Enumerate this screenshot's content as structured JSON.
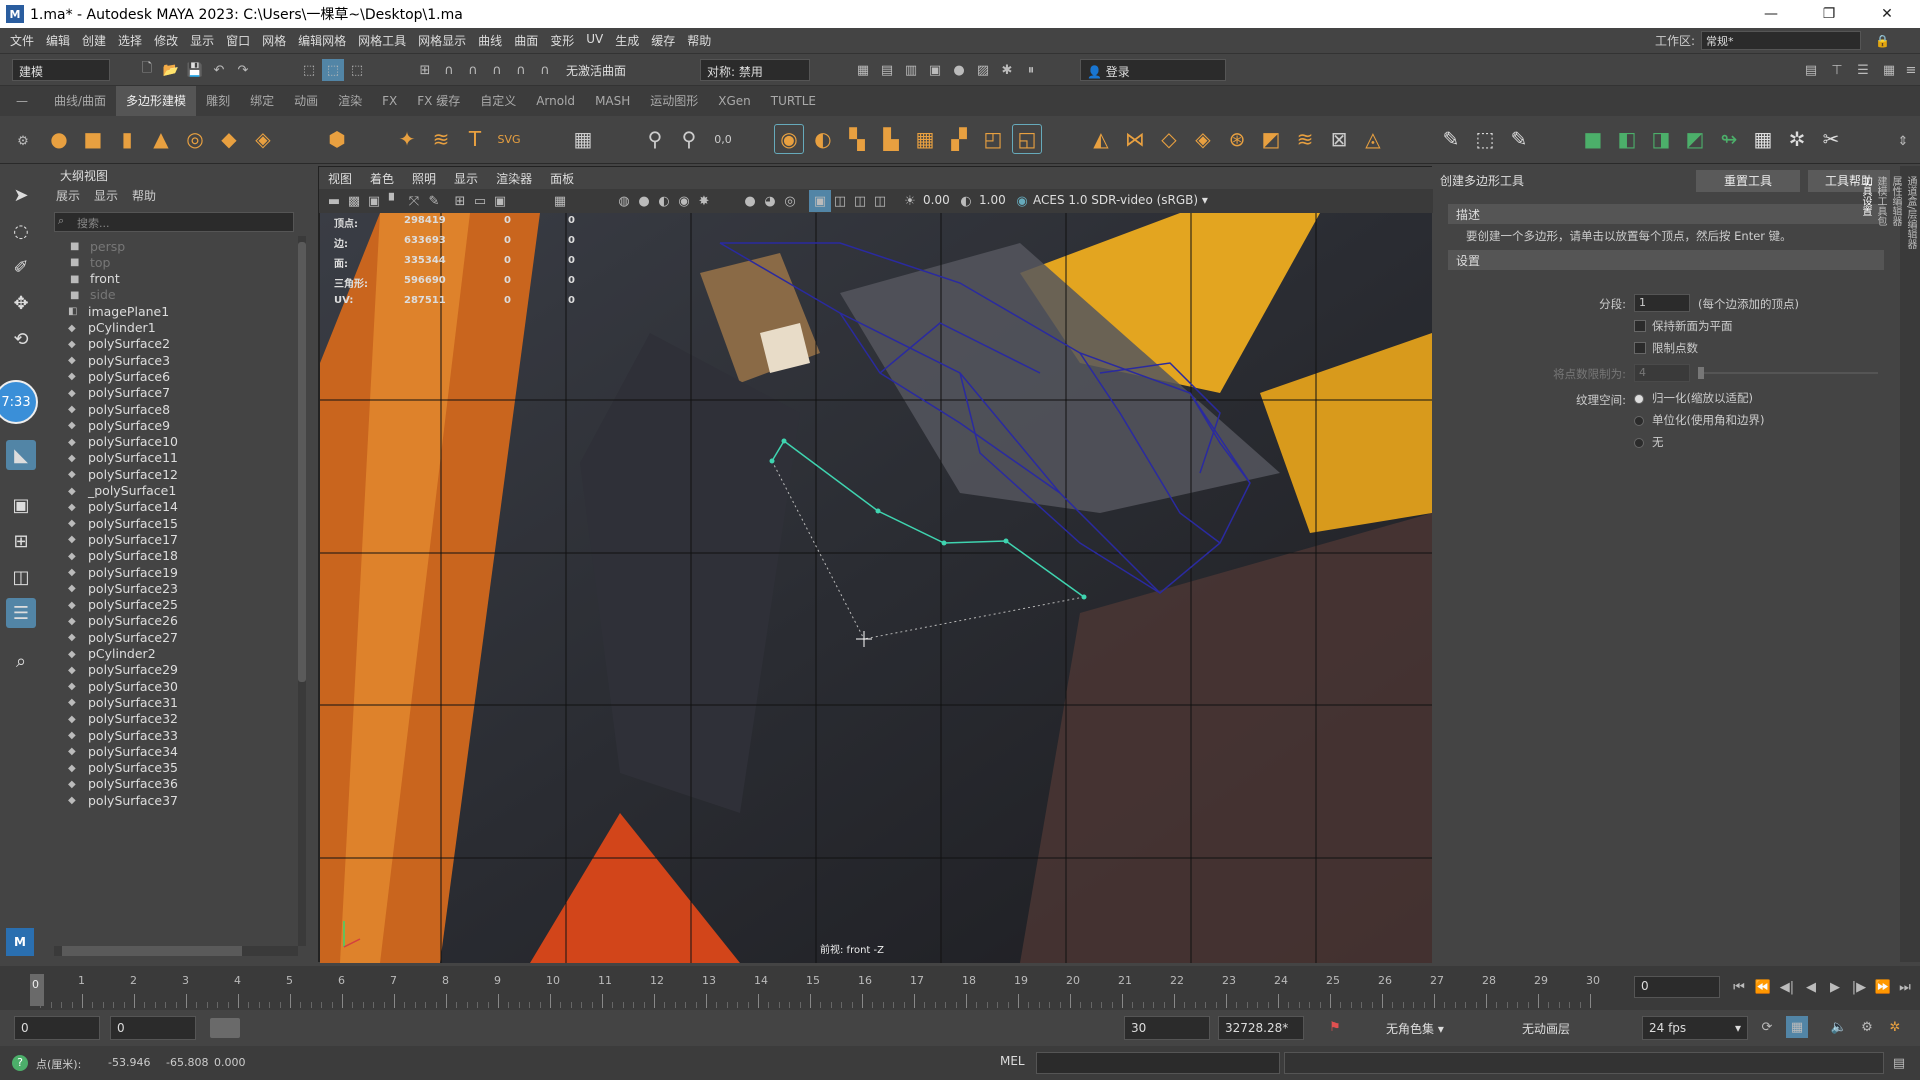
{
  "window": {
    "title": "1.ma* - Autodesk MAYA 2023: C:\\Users\\一棵草~\\Desktop\\1.ma",
    "logo": "M"
  },
  "menu": [
    "文件",
    "编辑",
    "创建",
    "选择",
    "修改",
    "显示",
    "窗口",
    "网格",
    "编辑网格",
    "网格工具",
    "网格显示",
    "曲线",
    "曲面",
    "变形",
    "UV",
    "生成",
    "缓存",
    "帮助"
  ],
  "workspace": {
    "label": "工作区:",
    "value": "常规*"
  },
  "statusline": {
    "mode": "建模",
    "live_surface": "无激活曲面",
    "symmetry": "对称: 禁用",
    "login": "登录"
  },
  "shelf_tabs": [
    "曲线/曲面",
    "多边形建模",
    "雕刻",
    "绑定",
    "动画",
    "渲染",
    "FX",
    "FX 缓存",
    "自定义",
    "Arnold",
    "MASH",
    "运动图形",
    "XGen",
    "TURTLE"
  ],
  "shelf_active": 1,
  "outliner": {
    "title": "大纲视图",
    "menu": [
      "展示",
      "显示",
      "帮助"
    ],
    "search_placeholder": "搜索...",
    "items": [
      "persp",
      "top",
      "front",
      "side",
      "imagePlane1",
      "pCylinder1",
      "polySurface2",
      "polySurface3",
      "polySurface6",
      "polySurface7",
      "polySurface8",
      "polySurface9",
      "polySurface10",
      "polySurface11",
      "polySurface12",
      "_polySurface1",
      "polySurface14",
      "polySurface15",
      "polySurface17",
      "polySurface18",
      "polySurface19",
      "polySurface23",
      "polySurface25",
      "polySurface26",
      "polySurface27",
      "pCylinder2",
      "polySurface29",
      "polySurface30",
      "polySurface31",
      "polySurface32",
      "polySurface33",
      "polySurface34",
      "polySurface35",
      "polySurface36",
      "polySurface37"
    ]
  },
  "viewport": {
    "menu": [
      "视图",
      "着色",
      "照明",
      "显示",
      "渲染器",
      "面板"
    ],
    "exposure": "0.00",
    "gamma": "1.00",
    "colorspace": "ACES 1.0 SDR-video (sRGB)",
    "camera_label": "前视: front -Z",
    "hud": [
      {
        "label": "顶点:",
        "v": "298419",
        "a": "0",
        "b": "0"
      },
      {
        "label": "边:",
        "v": "633693",
        "a": "0",
        "b": "0"
      },
      {
        "label": "面:",
        "v": "335344",
        "a": "0",
        "b": "0"
      },
      {
        "label": "三角形:",
        "v": "596690",
        "a": "0",
        "b": "0"
      },
      {
        "label": "UV:",
        "v": "287511",
        "a": "0",
        "b": "0"
      }
    ]
  },
  "tool_settings": {
    "title": "创建多边形工具",
    "reset": "重置工具",
    "help": "工具帮助",
    "desc_header": "描述",
    "desc": "要创建一个多边形，请单击以放置每个顶点，然后按 Enter 键。",
    "settings_header": "设置",
    "subdiv_label": "分段:",
    "subdiv_value": "1",
    "subdiv_hint": "(每个边添加的顶点)",
    "keep_planar": "保持新面为平面",
    "limit_points": "限制点数",
    "limit_label": "将点数限制为:",
    "limit_value": "4",
    "texture_label": "纹理空间:",
    "tex_opts": [
      "归一化(缩放以适配)",
      "单位化(使用角和边界)",
      "无"
    ]
  },
  "side_tabs": [
    "通道盒/层编辑器",
    "属性编辑器",
    "建模工具包",
    "工具设置"
  ],
  "hud_time": "7:33",
  "timeline": {
    "ticks": [
      "1",
      "2",
      "3",
      "4",
      "5",
      "6",
      "7",
      "8",
      "9",
      "10",
      "11",
      "12",
      "13",
      "14",
      "15",
      "16",
      "17",
      "18",
      "19",
      "20",
      "21",
      "22",
      "23",
      "24",
      "25",
      "26",
      "27",
      "28",
      "29",
      "30"
    ],
    "current": "0",
    "frame_field": "0"
  },
  "range": {
    "start": "0",
    "start2": "0",
    "end": "30",
    "end2": "32728.28*",
    "charset": "无角色集",
    "anim_layer": "无动画层",
    "fps": "24 fps"
  },
  "cmd": {
    "coord_label": "点(厘米):",
    "x": "-53.946",
    "y": "-65.808",
    "z": "0.000",
    "lang": "MEL"
  }
}
